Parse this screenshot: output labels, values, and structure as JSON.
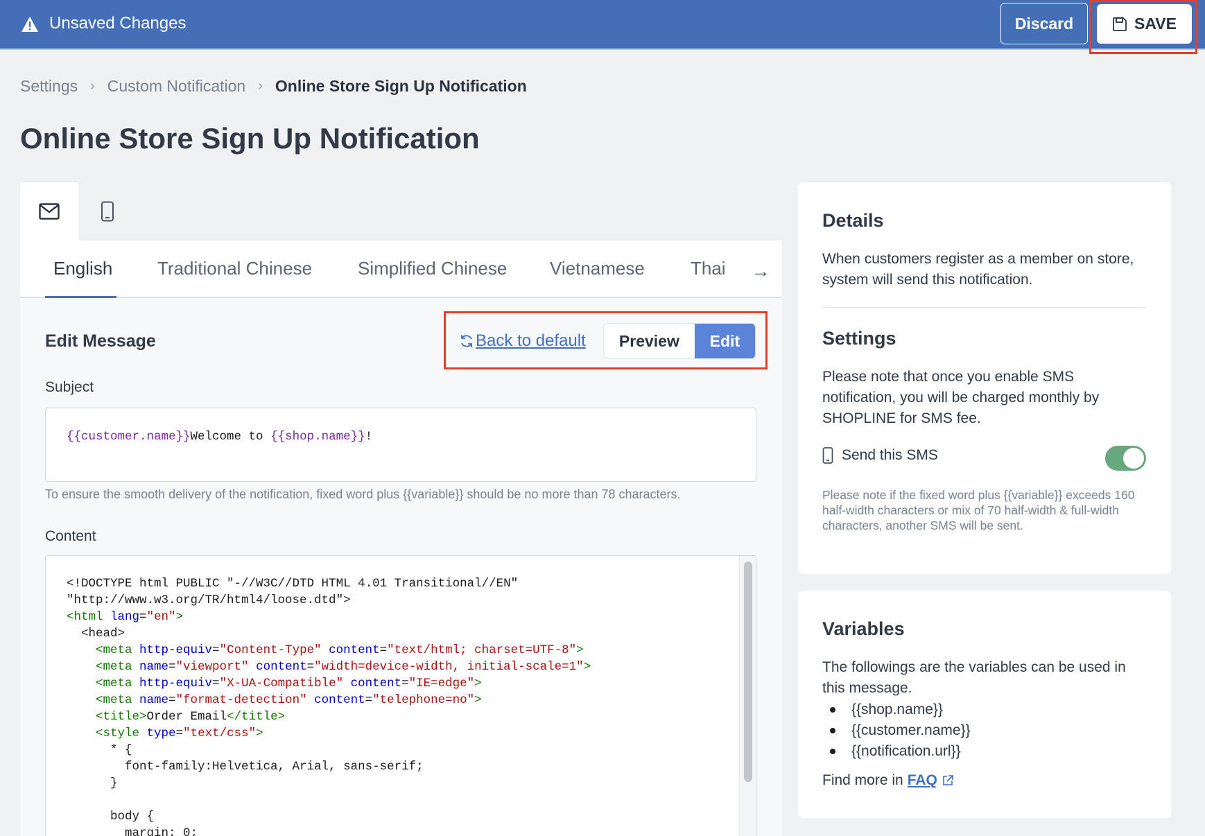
{
  "topbar": {
    "unsaved_label": "Unsaved Changes",
    "discard_label": "Discard",
    "save_label": "SAVE"
  },
  "breadcrumb": {
    "items": [
      "Settings",
      "Custom Notification",
      "Online Store Sign Up Notification"
    ]
  },
  "page_title": "Online Store Sign Up Notification",
  "channel_tabs": [
    {
      "icon": "mail-icon",
      "active": true
    },
    {
      "icon": "mobile-icon",
      "active": false
    }
  ],
  "languages": {
    "tabs": [
      "English",
      "Traditional Chinese",
      "Simplified Chinese",
      "Vietnamese",
      "Thai"
    ],
    "active": "English"
  },
  "edit_message": {
    "title": "Edit Message",
    "back_default_label": "Back to default",
    "preview_label": "Preview",
    "edit_label": "Edit",
    "active_mode": "Edit",
    "subject_label": "Subject",
    "subject_var1": "{{customer.name}}",
    "subject_text1": "Welcome to ",
    "subject_var2": "{{shop.name}}",
    "subject_text2": "!",
    "subject_hint": "To ensure the smooth delivery of the notification, fixed word plus {{variable}} should be no more than 78 characters.",
    "content_label": "Content",
    "code": {
      "l1": "<!DOCTYPE html PUBLIC \"-//W3C//DTD HTML 4.01 Transitional//EN\"",
      "l2": "\"http://www.w3.org/TR/html4/loose.dtd\">",
      "l3_tag": "<html",
      "l3_attr": " lang",
      "l3_eq": "=",
      "l3_val": "\"en\"",
      "l3_end": ">",
      "l4": "  <head>",
      "l5_tag": "    <meta",
      "l5_a1": " http-equiv",
      "l5_v1": "\"Content-Type\"",
      "l5_a2": " content",
      "l5_v2": "\"text/html; charset=UTF-8\"",
      "l6_tag": "    <meta",
      "l6_a1": " name",
      "l6_v1": "\"viewport\"",
      "l6_a2": " content",
      "l6_v2": "\"width=device-width, initial-scale=1\"",
      "l7_tag": "    <meta",
      "l7_a1": " http-equiv",
      "l7_v1": "\"X-UA-Compatible\"",
      "l7_a2": " content",
      "l7_v2": "\"IE=edge\"",
      "l8_tag": "    <meta",
      "l8_a1": " name",
      "l8_v1": "\"format-detection\"",
      "l8_a2": " content",
      "l8_v2": "\"telephone=no\"",
      "l9_open": "    <title>",
      "l9_text": "Order Email",
      "l9_close": "</title>",
      "l10_tag": "    <style",
      "l10_a1": " type",
      "l10_v1": "\"text/css\"",
      "l11": "      * {",
      "l12": "        font-family:Helvetica, Arial, sans-serif;",
      "l13": "      }",
      "l14": "",
      "l15": "      body {",
      "l16": "        margin: 0;"
    }
  },
  "details": {
    "title": "Details",
    "text": "When customers register as a member on store, system will send this notification."
  },
  "settings": {
    "title": "Settings",
    "text": "Please note that once you enable SMS notification, you will be charged monthly by SHOPLINE for SMS fee.",
    "sms_label": "Send this SMS",
    "sms_enabled": true,
    "sms_note": "Please note if the fixed word plus {{variable}} exceeds 160 half-width characters or mix of 70 half-width & full-width characters, another SMS will be sent."
  },
  "variables": {
    "title": "Variables",
    "text": "The followings are the variables can be used in this message.",
    "items": [
      "{{shop.name}}",
      "{{customer.name}}",
      "{{notification.url}}"
    ],
    "find_more": "Find more in",
    "faq_label": "FAQ"
  },
  "colors": {
    "topbar": "#446eb5",
    "accent": "#5b83d8",
    "link": "#3f6fc8",
    "highlight": "#e0402e",
    "switch_on": "#67a880"
  }
}
